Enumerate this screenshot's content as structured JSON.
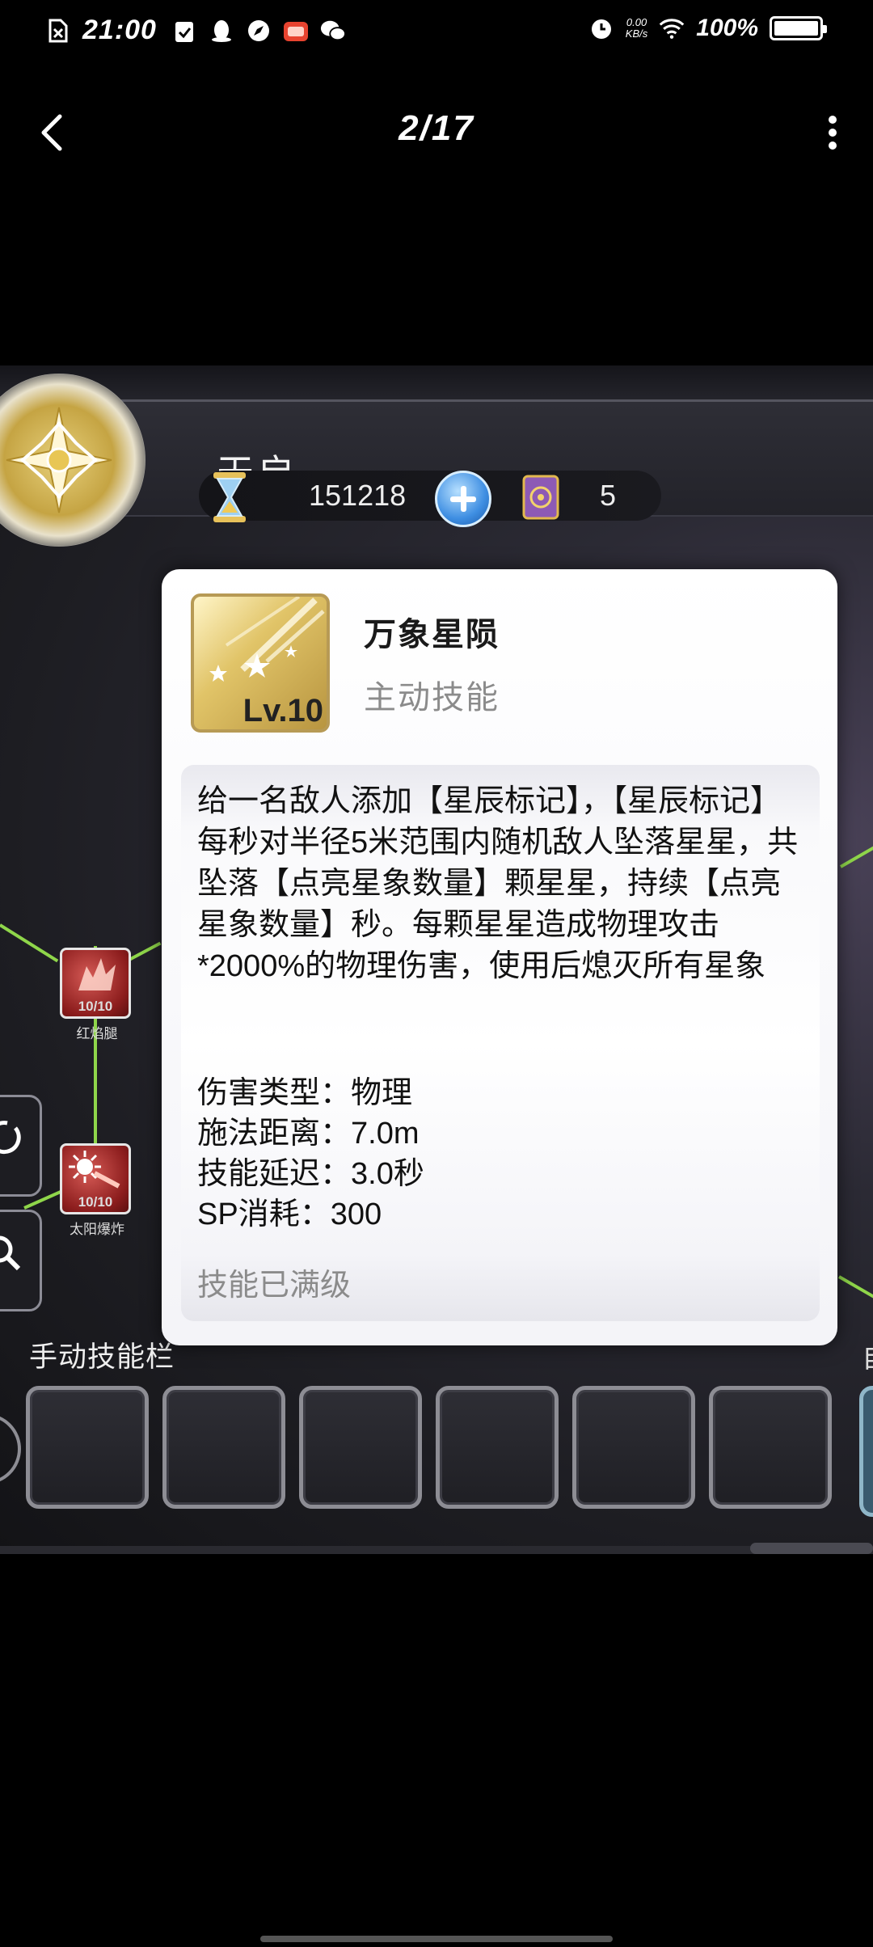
{
  "status_bar": {
    "time": "21:00",
    "net_speed_value": "0.00",
    "net_speed_unit": "KB/s",
    "battery_text": "100%",
    "battery_level_percent": 100
  },
  "nav": {
    "page_counter": "2/17"
  },
  "game": {
    "character_name": "天启",
    "resource_1": "151218",
    "resource_2": "5",
    "skill_nodes": [
      {
        "level": "10/10",
        "label": "红焰腿"
      },
      {
        "level": "10/10",
        "label": "太阳爆炸"
      }
    ],
    "manual_bar_title": "手动技能栏",
    "right_edge_text": "自"
  },
  "card": {
    "icon_level": "Lv.10",
    "skill_name": "万象星陨",
    "skill_type": "主动技能",
    "description": "给一名敌人添加【星辰标记】，【星辰标记】每秒对半径5米范围内随机敌人坠落星星，共坠落【点亮星象数量】颗星星，持续【点亮星象数量】秒。每颗星星造成物理攻击*2000%的物理伤害，使用后熄灭所有星象",
    "stats": [
      "伤害类型：物理",
      "施法距离：7.0m",
      "技能延迟：3.0秒",
      "SP消耗：300"
    ],
    "status": "技能已满级"
  }
}
